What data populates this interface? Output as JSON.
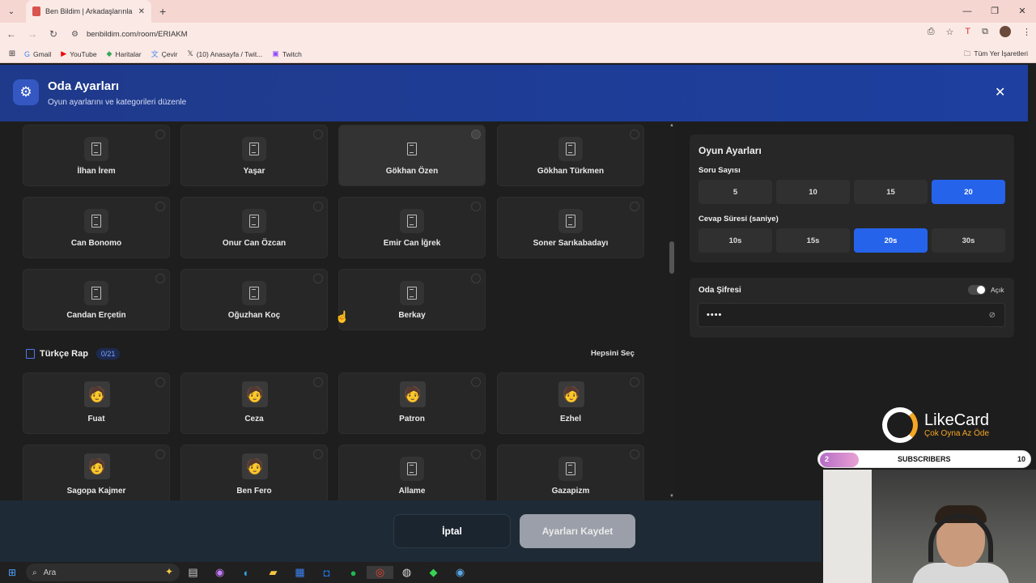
{
  "browser": {
    "tab_title": "Ben Bildim | Arkadaşlarınla Onl...",
    "url": "benbildim.com/room/ERIAKM",
    "bookmarks": [
      {
        "icon": "google-icon",
        "label": "Gmail"
      },
      {
        "icon": "youtube-icon",
        "label": "YouTube"
      },
      {
        "icon": "maps-icon",
        "label": "Haritalar"
      },
      {
        "icon": "translate-icon",
        "label": "Çevir"
      },
      {
        "icon": "x-icon",
        "label": "(10) Anasayfa / Twit..."
      },
      {
        "icon": "twitch-icon",
        "label": "Twitch"
      }
    ],
    "all_bookmarks": "Tüm Yer İşaretleri"
  },
  "header": {
    "title": "Oda Ayarları",
    "subtitle": "Oyun ayarlarını ve kategorileri düzenle"
  },
  "cards_top": [
    {
      "name": "İlhan İrem",
      "selected": false
    },
    {
      "name": "Yaşar",
      "selected": false
    },
    {
      "name": "Gökhan Özen",
      "selected": true
    },
    {
      "name": "Gökhan Türkmen",
      "selected": false
    },
    {
      "name": "Can Bonomo",
      "selected": false
    },
    {
      "name": "Onur Can Özcan",
      "selected": false
    },
    {
      "name": "Emir Can İğrek",
      "selected": false
    },
    {
      "name": "Soner Sarıkabadayı",
      "selected": false
    },
    {
      "name": "Candan Erçetin",
      "selected": false
    },
    {
      "name": "Oğuzhan Koç",
      "selected": false
    },
    {
      "name": "Berkay",
      "selected": false
    }
  ],
  "section": {
    "title": "Türkçe Rap",
    "count": "0/21",
    "select_all": "Hepsini Seç"
  },
  "cards_rap": [
    {
      "name": "Fuat",
      "avatar": true
    },
    {
      "name": "Ceza",
      "avatar": true
    },
    {
      "name": "Patron",
      "avatar": true
    },
    {
      "name": "Ezhel",
      "avatar": true
    },
    {
      "name": "Sagopa Kajmer",
      "avatar": true
    },
    {
      "name": "Ben Fero",
      "avatar": true
    },
    {
      "name": "Allame",
      "avatar": false
    },
    {
      "name": "Gazapizm",
      "avatar": false
    }
  ],
  "game_settings": {
    "title": "Oyun Ayarları",
    "question_count_label": "Soru Sayısı",
    "question_counts": [
      "5",
      "10",
      "15",
      "20"
    ],
    "question_selected": "20",
    "answer_time_label": "Cevap Süresi (saniye)",
    "answer_times": [
      "10s",
      "15s",
      "20s",
      "30s"
    ],
    "answer_selected": "20s"
  },
  "password": {
    "label": "Oda Şifresi",
    "toggle_label": "Açık",
    "value": "••••"
  },
  "footer": {
    "cancel": "İptal",
    "save": "Ayarları Kaydet"
  },
  "overlay": {
    "brand": "LikeCard",
    "slogan": "Çok Oyna Az Öde",
    "sub_count": "2",
    "sub_label": "SUBSCRIBERS",
    "sub_goal": "10"
  },
  "taskbar": {
    "search_placeholder": "Ara"
  }
}
